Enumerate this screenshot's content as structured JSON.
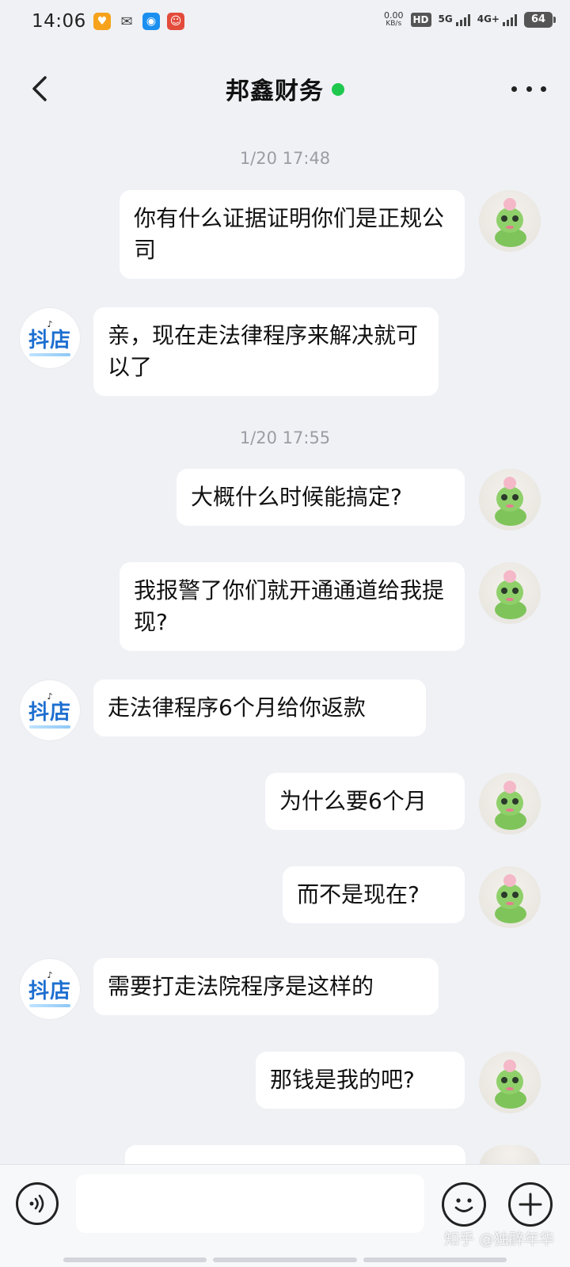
{
  "status_bar": {
    "time": "14:06",
    "net_speed_value": "0.00",
    "net_speed_unit": "KB/s",
    "hd": "HD",
    "sim1_label": "5G",
    "sim2_label": "4G+",
    "battery": "64"
  },
  "header": {
    "title": "邦鑫财务",
    "online": true
  },
  "shop_avatar": {
    "logo_text": "抖店"
  },
  "messages": [
    {
      "type": "timestamp",
      "text": "1/20 17:48"
    },
    {
      "type": "sent",
      "text": "你有什么证据证明你们是正规公司"
    },
    {
      "type": "received",
      "text": "亲，现在走法律程序来解决就可以了"
    },
    {
      "type": "timestamp",
      "text": "1/20 17:55"
    },
    {
      "type": "sent",
      "text": "大概什么时候能搞定?"
    },
    {
      "type": "sent",
      "text": "我报警了你们就开通通道给我提现?"
    },
    {
      "type": "received",
      "text": "走法律程序6个月给你返款"
    },
    {
      "type": "sent",
      "text": "为什么要6个月"
    },
    {
      "type": "sent",
      "text": "而不是现在?"
    },
    {
      "type": "received",
      "text": "需要打走法院程序是这样的"
    },
    {
      "type": "sent",
      "text": "那钱是我的吧?"
    }
  ],
  "input": {
    "placeholder": ""
  },
  "watermark": "知乎 @独醉年华",
  "colors": {
    "online_dot": "#1ec84d",
    "shop_blue": "#1d6fd0",
    "background": "#eff1f5"
  }
}
